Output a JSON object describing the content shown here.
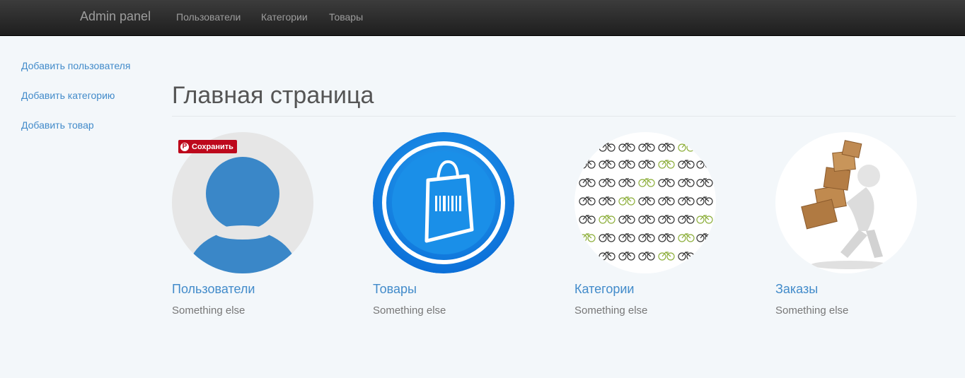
{
  "navbar": {
    "brand": "Admin panel",
    "links": [
      "Пользователи",
      "Категории",
      "Товары"
    ]
  },
  "sidebar": {
    "items": [
      "Добавить пользователя",
      "Добавить категорию",
      "Добавить товар"
    ]
  },
  "main": {
    "title": "Главная страница",
    "tiles": [
      {
        "title": "Пользователи",
        "subtitle": "Something else",
        "icon": "user-avatar-icon"
      },
      {
        "title": "Товары",
        "subtitle": "Something else",
        "icon": "shopping-bag-icon"
      },
      {
        "title": "Категории",
        "subtitle": "Something else",
        "icon": "bicycles-collage-image"
      },
      {
        "title": "Заказы",
        "subtitle": "Something else",
        "icon": "person-carrying-boxes-image"
      }
    ]
  },
  "pin_button": {
    "label": "Сохранить"
  },
  "colors": {
    "navbar": "#222222",
    "link": "#428bca",
    "background": "#f3f7fa",
    "bag_blue": "#1a8fe8",
    "pin_red": "#bd081c"
  }
}
